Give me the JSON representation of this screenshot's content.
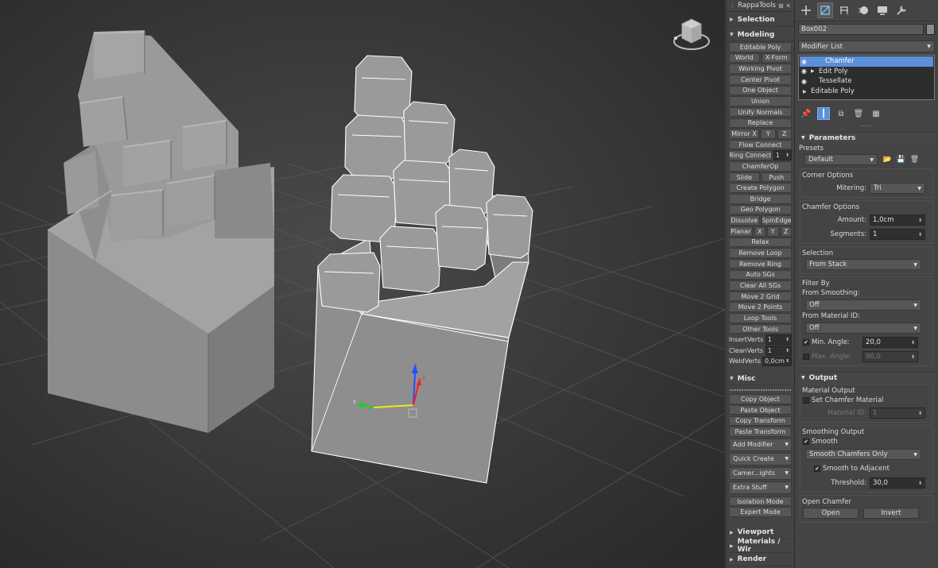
{
  "rappa": {
    "title": "RappaTools",
    "title_close": "⊠ ✕",
    "sections": {
      "selection": "Selection",
      "modeling": "Modeling",
      "misc": "Misc",
      "viewport": "Viewport",
      "materials": "Materials / Wir",
      "render": "Render"
    },
    "modeling": {
      "editable_poly": "Editable Poly",
      "world": "World",
      "xform": "X-Form",
      "working_pivot": "Working Pivot",
      "center_pivot": "Center Pivot",
      "one_object": "One Object",
      "union": "Union",
      "unify_normals": "Unify Normals",
      "replace": "Replace",
      "mirror_x": "Mirror X",
      "mirror_y": "Y",
      "mirror_z": "Z",
      "flow_connect": "Flow Connect",
      "ring_connect": "Ring Connect",
      "ring_connect_val": "1",
      "chamferop": "ChamferOp",
      "slide": "Slide",
      "push": "Push",
      "create_polygon": "Create Polygon",
      "bridge": "Bridge",
      "geo_polygon": "Geo Polygon",
      "dissolve": "Dissolve",
      "spinedge": "SpinEdge",
      "planar": "Planar",
      "planar_x": "X",
      "planar_y": "Y",
      "planar_z": "Z",
      "relax": "Relax",
      "remove_loop": "Remove Loop",
      "remove_ring": "Remove Ring",
      "auto_sgs": "Auto SGs",
      "clear_all_sgs": "Clear All SGs",
      "move_2_grid": "Move 2 Grid",
      "move_2_points": "Move 2 Points",
      "loop_tools": "Loop Tools",
      "other_tools": "Other Tools",
      "insert_verts": "InsertVerts",
      "insert_verts_val": "1",
      "clean_verts": "CleanVerts",
      "clean_verts_val": "1",
      "weld_verts": "WeldVerts",
      "weld_verts_val": "0,0cm"
    },
    "misc": {
      "copy_object": "Copy Object",
      "paste_object": "Paste Object",
      "copy_transform": "Copy Transform",
      "paste_transform": "Paste Transform",
      "add_modifier": "Add Modifier",
      "quick_create": "Quick Create",
      "camera_lights": "Camer...ights",
      "extra_stuff": "Extra Stuff",
      "isolation_mode": "Isolation Mode",
      "expert_mode": "Expert Mode"
    }
  },
  "cmd": {
    "object_name": "Box002",
    "modifier_list": "Modifier List",
    "stack": [
      {
        "label": "Chamfer",
        "selected": true
      },
      {
        "label": "Edit Poly",
        "selected": false
      },
      {
        "label": "Tessellate",
        "selected": false
      },
      {
        "label": "Editable Poly",
        "selected": false
      }
    ],
    "parameters": {
      "title": "Parameters",
      "presets_label": "Presets",
      "presets_value": "Default",
      "corner_options": "Corner Options",
      "mitering_label": "Mitering:",
      "mitering_value": "Tri",
      "chamfer_options": "Chamfer Options",
      "amount_label": "Amount:",
      "amount_value": "1,0cm",
      "segments_label": "Segments:",
      "segments_value": "1",
      "selection_label": "Selection",
      "selection_value": "From Stack",
      "filter_by": "Filter By",
      "from_smoothing": "From Smoothing:",
      "from_smoothing_value": "Off",
      "from_material_id": "From Material ID:",
      "from_material_id_value": "Off",
      "min_angle_label": "Min. Angle:",
      "min_angle_value": "20,0",
      "max_angle_label": "Max. Angle:",
      "max_angle_value": "90,0"
    },
    "output": {
      "title": "Output",
      "material_output": "Material Output",
      "set_chamfer_material": "Set Chamfer Material",
      "material_id_label": "Material ID:",
      "material_id_value": "1",
      "smoothing_output": "Smoothing Output",
      "smooth": "Smooth",
      "smooth_mode": "Smooth Chamfers Only",
      "smooth_to_adjacent": "Smooth to Adjacent",
      "threshold_label": "Threshold:",
      "threshold_value": "30,0",
      "open_chamfer": "Open Chamfer",
      "open": "Open",
      "invert": "Invert"
    }
  }
}
